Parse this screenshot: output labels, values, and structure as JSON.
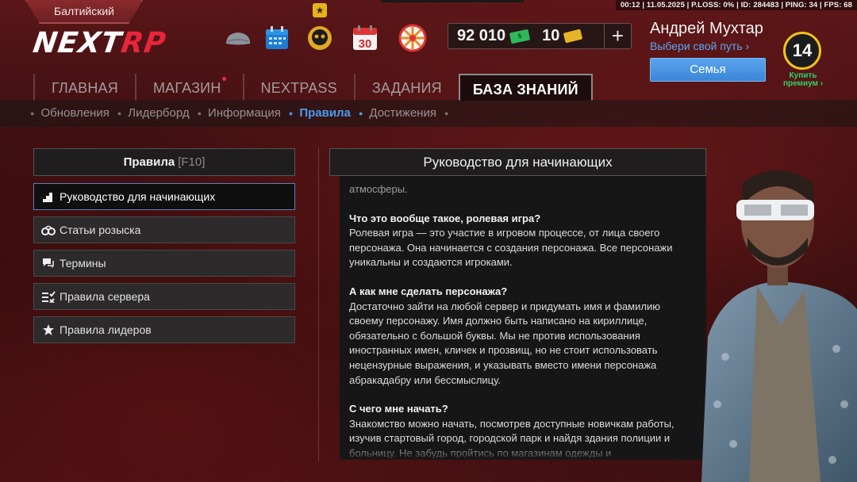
{
  "status_bar": "00:12 | 11.05.2025 | P.LOSS: 0% | ID: 284483 | PING: 34 | FPS: 68",
  "server": "Балтийский",
  "logo": {
    "part1": "NEXT",
    "part2": "RP"
  },
  "top_icons": [
    "cap-icon",
    "calendar-icon",
    "skull-icon",
    "calendar-30-icon",
    "wheel-icon"
  ],
  "calendar_day": "30",
  "currency": {
    "money": "92 010",
    "coins": "10",
    "add_label": "+"
  },
  "player": {
    "name": "Андрей Мухтар",
    "path_link": "Выбери свой путь",
    "family_button": "Семья",
    "level": "14",
    "premium_label_1": "Купить",
    "premium_label_2": "премиум"
  },
  "main_nav": [
    {
      "label": "ГЛАВНАЯ"
    },
    {
      "label": "МАГАЗИН"
    },
    {
      "label": "NEXTPASS"
    },
    {
      "label": "ЗАДАНИЯ"
    },
    {
      "label": "БАЗА ЗНАНИЙ"
    }
  ],
  "sub_nav": [
    {
      "label": "Обновления"
    },
    {
      "label": "Лидерборд"
    },
    {
      "label": "Информация"
    },
    {
      "label": "Правила"
    },
    {
      "label": "Достижения"
    }
  ],
  "left_panel": {
    "title": "Правила",
    "hotkey": "[F10]",
    "items": [
      {
        "label": "Руководство для начинающих",
        "icon": "stairs-icon"
      },
      {
        "label": "Статьи розыска",
        "icon": "handcuffs-icon"
      },
      {
        "label": "Термины",
        "icon": "chat-icon"
      },
      {
        "label": "Правила сервера",
        "icon": "checklist-icon"
      },
      {
        "label": "Правила лидеров",
        "icon": "star-icon"
      }
    ]
  },
  "right_panel": {
    "title": "Руководство для начинающих",
    "intro_fragment": "атмосферы.",
    "sections": [
      {
        "q": "Что это вообще такое, ролевая игра?",
        "a": "Ролевая игра — это участие в игровом процессе, от лица своего персонажа. Она начинается с создания персонажа. Все персонажи уникальны и создаются игроками."
      },
      {
        "q": "А как мне сделать персонажа?",
        "a": "Достаточно зайти на любой сервер и придумать имя и фамилию своему персонажу. Имя должно быть написано на кириллице, обязательно с большой буквы. Мы не против использования иностранных имен, кличек и прозвищ, но не стоит использовать нецензурные выражения, и указывать вместо имени персонажа абракадабру или бессмыслицу."
      },
      {
        "q": "С чего мне начать?",
        "a": "Знакомство можно начать, посмотрев доступные новичкам работы, изучив стартовый город, городской парк и найдя здания полиции и больницу. Не забудь пройтись по магазинам одежды и"
      }
    ]
  },
  "colors": {
    "accent_blue": "#4c9aee",
    "level_ring": "#f2c318",
    "premium_green": "#2fd36a",
    "logo_red": "#e8253a"
  }
}
